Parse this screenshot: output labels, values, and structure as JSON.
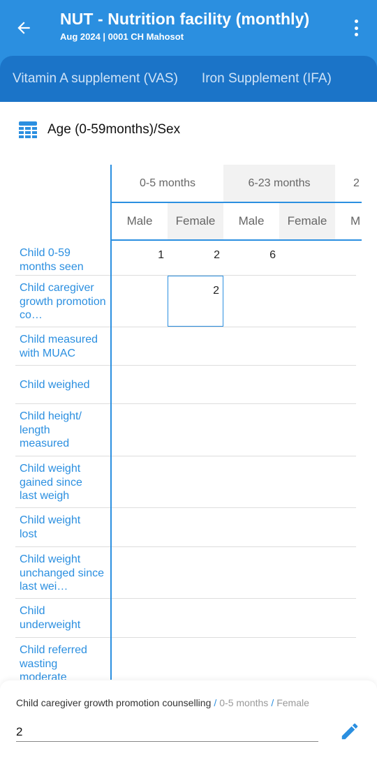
{
  "header": {
    "title": "NUT - Nutrition facility (monthly)",
    "subtitle": "Aug 2024 | 0001 CH Mahosot"
  },
  "tabs": [
    {
      "label": "Vitamin A supplement (VAS)"
    },
    {
      "label": "Iron Supplement (IFA)"
    }
  ],
  "section": {
    "icon": "table-icon",
    "title": "Age (0-59months)/Sex"
  },
  "table": {
    "groups": [
      "0-5 months",
      "6-23 months",
      "2"
    ],
    "subheaders": [
      "Male",
      "Female",
      "Male",
      "Female",
      "M"
    ],
    "rows": [
      {
        "label": "Child 0-59 months seen",
        "values": [
          "1",
          "2",
          "6",
          ""
        ]
      },
      {
        "label": "Child caregiver growth promotion co…",
        "values": [
          "",
          "2",
          "",
          ""
        ]
      },
      {
        "label": "Child measured with MUAC",
        "values": [
          "",
          "",
          "",
          ""
        ]
      },
      {
        "label": "Child weighed",
        "values": [
          "",
          "",
          "",
          ""
        ]
      },
      {
        "label": "Child height/ length measured",
        "values": [
          "",
          "",
          "",
          ""
        ]
      },
      {
        "label": "Child weight gained since last weigh",
        "values": [
          "",
          "",
          "",
          ""
        ]
      },
      {
        "label": "Child weight lost",
        "values": [
          "",
          "",
          "",
          ""
        ]
      },
      {
        "label": "Child weight unchanged since last wei…",
        "values": [
          "",
          "",
          "",
          ""
        ]
      },
      {
        "label": "Child underweight",
        "values": [
          "",
          "",
          "",
          ""
        ]
      },
      {
        "label": "Child referred wasting moderate",
        "values": [
          "",
          "",
          "",
          ""
        ]
      }
    ]
  },
  "editor": {
    "crumb_field": "Child caregiver growth promotion counselling",
    "crumb_sep": "/",
    "crumb_group": "0-5 months",
    "crumb_sub": "Female",
    "value": "2"
  },
  "colors": {
    "primary": "#2b8fe0",
    "tab_bar": "#1b74c8"
  }
}
